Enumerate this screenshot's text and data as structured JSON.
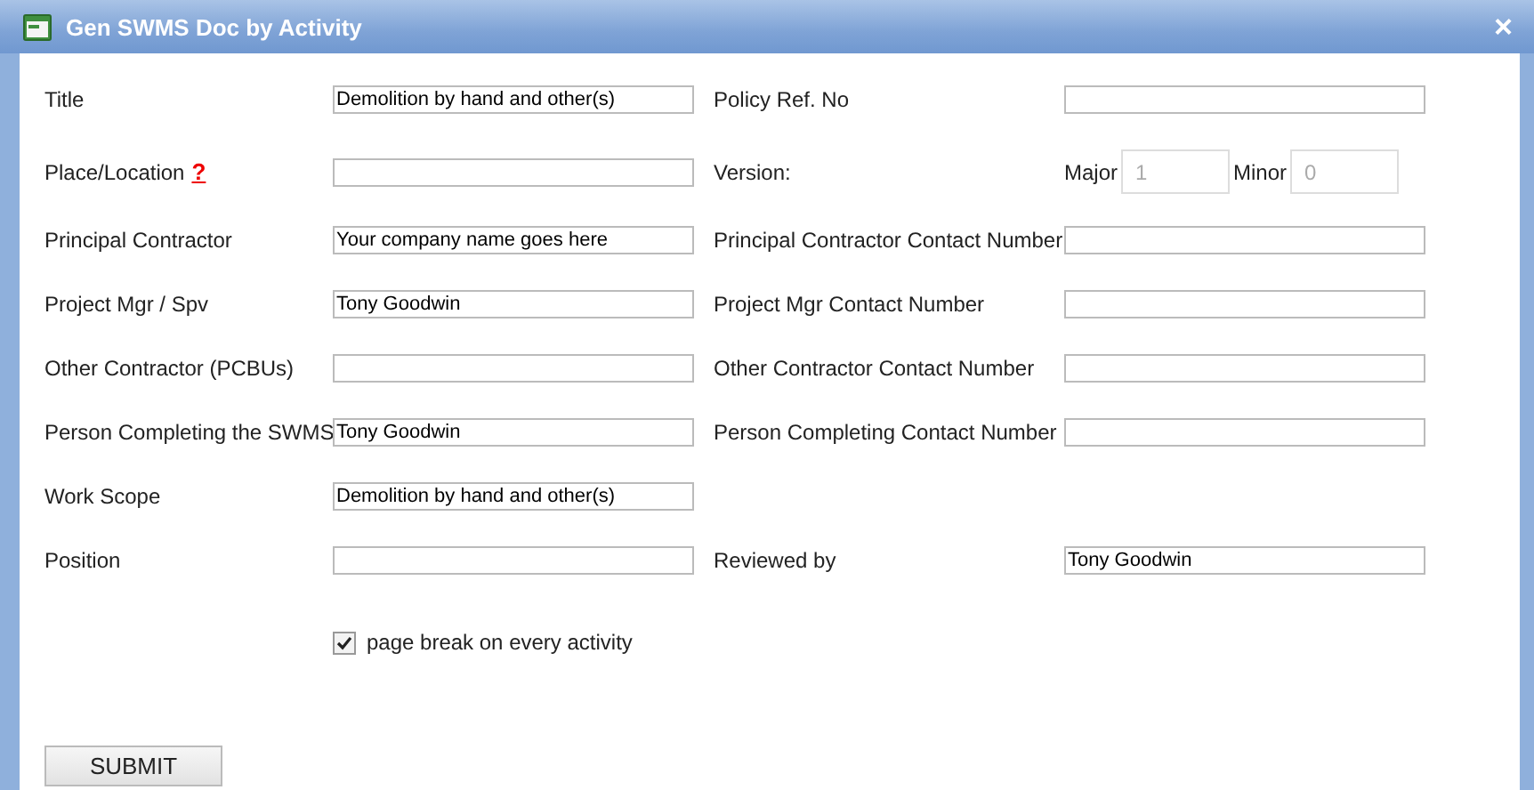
{
  "window": {
    "title": "Gen SWMS Doc by Activity",
    "close": "×"
  },
  "rows": [
    {
      "left": {
        "label": "Title",
        "value": "Demolition by hand and other(s)"
      },
      "right": {
        "kind": "field",
        "label": "Policy Ref. No"
      }
    },
    {
      "left": {
        "label": "Place/Location",
        "help": "?"
      },
      "right": {
        "kind": "version",
        "label": "Version:",
        "major_label": "Major",
        "major_value": "1",
        "minor_label": "Minor",
        "minor_value": "0",
        "disabled": true
      }
    },
    {
      "left": {
        "label": "Principal Contractor",
        "value": "Your company name goes here"
      },
      "right": {
        "kind": "field",
        "label": "Principal Contractor Contact Number"
      }
    },
    {
      "left": {
        "label": "Project Mgr / Spv",
        "value": "Tony Goodwin"
      },
      "right": {
        "kind": "field",
        "label": "Project Mgr Contact Number"
      }
    },
    {
      "left": {
        "label": "Other Contractor (PCBUs)"
      },
      "right": {
        "kind": "field",
        "label": "Other Contractor Contact Number"
      }
    },
    {
      "left": {
        "label": "Person Completing the SWMS",
        "value": "Tony Goodwin"
      },
      "right": {
        "kind": "field",
        "label": "Person Completing Contact Number"
      }
    },
    {
      "left": {
        "label": "Work Scope",
        "value": "Demolition by hand and other(s)"
      }
    },
    {
      "left": {
        "label": "Position"
      },
      "right": {
        "kind": "field",
        "label": "Reviewed by",
        "value": "Tony Goodwin"
      }
    }
  ],
  "page_break": {
    "label": "page break on every activity",
    "checked": true
  },
  "submit": "SUBMIT"
}
